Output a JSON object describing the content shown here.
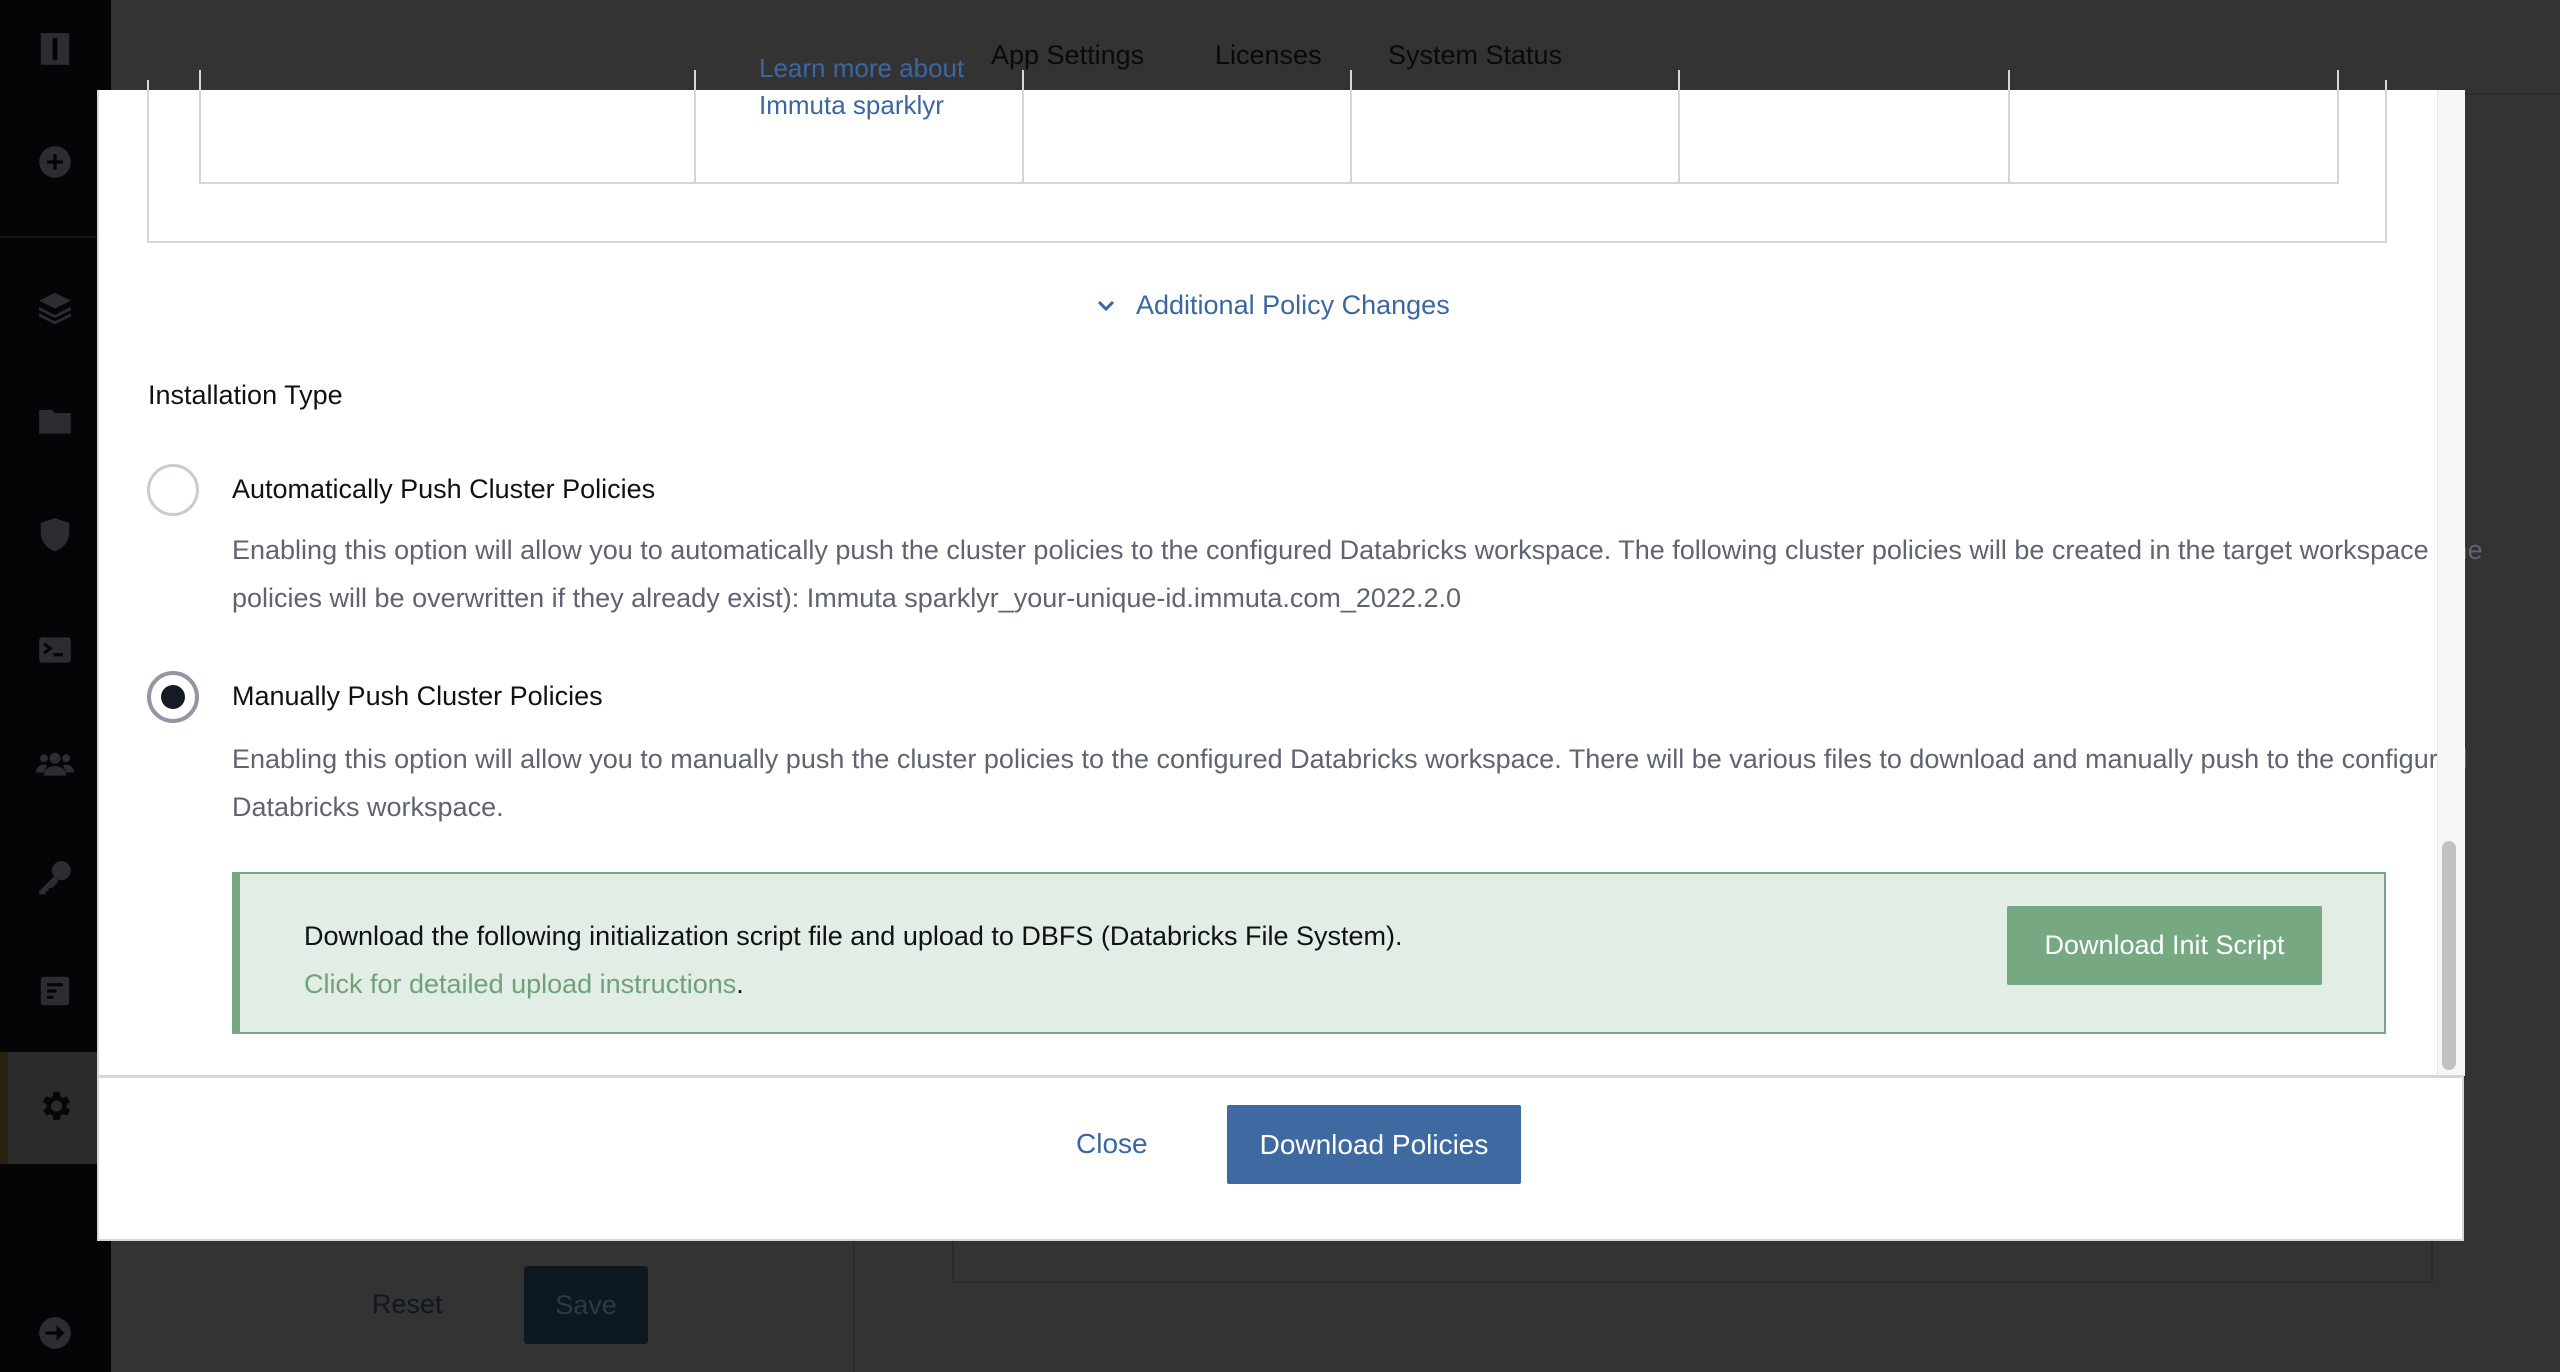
{
  "header": {
    "nav": [
      "App Settings",
      "Licenses",
      "System Status"
    ]
  },
  "sidebar": {
    "icons": [
      "logo-icon",
      "add-icon",
      "layers-icon",
      "folder-icon",
      "shield-icon",
      "terminal-icon",
      "users-icon",
      "key-icon",
      "audit-icon",
      "settings-icon",
      "logout-icon"
    ],
    "active": "settings-icon"
  },
  "background": {
    "reset_label": "Reset",
    "save_label": "Save"
  },
  "modal": {
    "table_link_line1": "Learn more about",
    "table_link_line2": "Immuta sparklyr",
    "additional_policy_changes": "Additional Policy Changes",
    "installation_type_label": "Installation Type",
    "options": [
      {
        "label": "Automatically Push Cluster Policies",
        "selected": false,
        "description": "Enabling this option will allow you to automatically push the cluster policies to the configured Databricks workspace. The following cluster policies will be created in the target workspace (the policies will be overwritten if they already exist): Immuta sparklyr_your-unique-id.immuta.com_2022.2.0"
      },
      {
        "label": "Manually Push Cluster Policies",
        "selected": true,
        "description": "Enabling this option will allow you to manually push the cluster policies to the configured Databricks workspace. There will be various files to download and manually push to the configured Databricks workspace."
      }
    ],
    "notice": {
      "text": "Download the following initialization script file and upload to DBFS (Databricks File System).",
      "link": "Click for detailed upload instructions",
      "link_suffix": ".",
      "button": "Download Init Script"
    },
    "footer": {
      "close": "Close",
      "download": "Download Policies"
    },
    "colors": {
      "primary": "#3e6aa1",
      "success": "#76a982",
      "notice_bg": "#e2ede5"
    }
  }
}
